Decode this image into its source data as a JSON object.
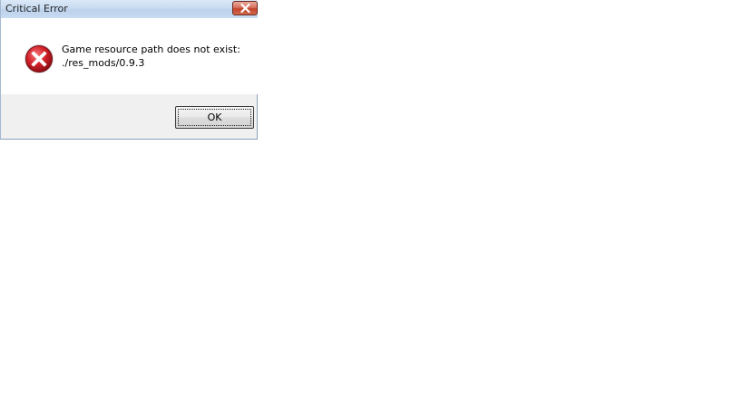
{
  "window": {
    "title": "Critical Error",
    "close_icon": "close-x-icon"
  },
  "message": {
    "icon": "error-icon",
    "line1": "Game resource path does not exist:",
    "line2": "./res_mods/0.9.3"
  },
  "buttons": {
    "ok_label": "OK"
  },
  "colors": {
    "close_button": "#c3432c",
    "error_icon": "#d3202a"
  }
}
